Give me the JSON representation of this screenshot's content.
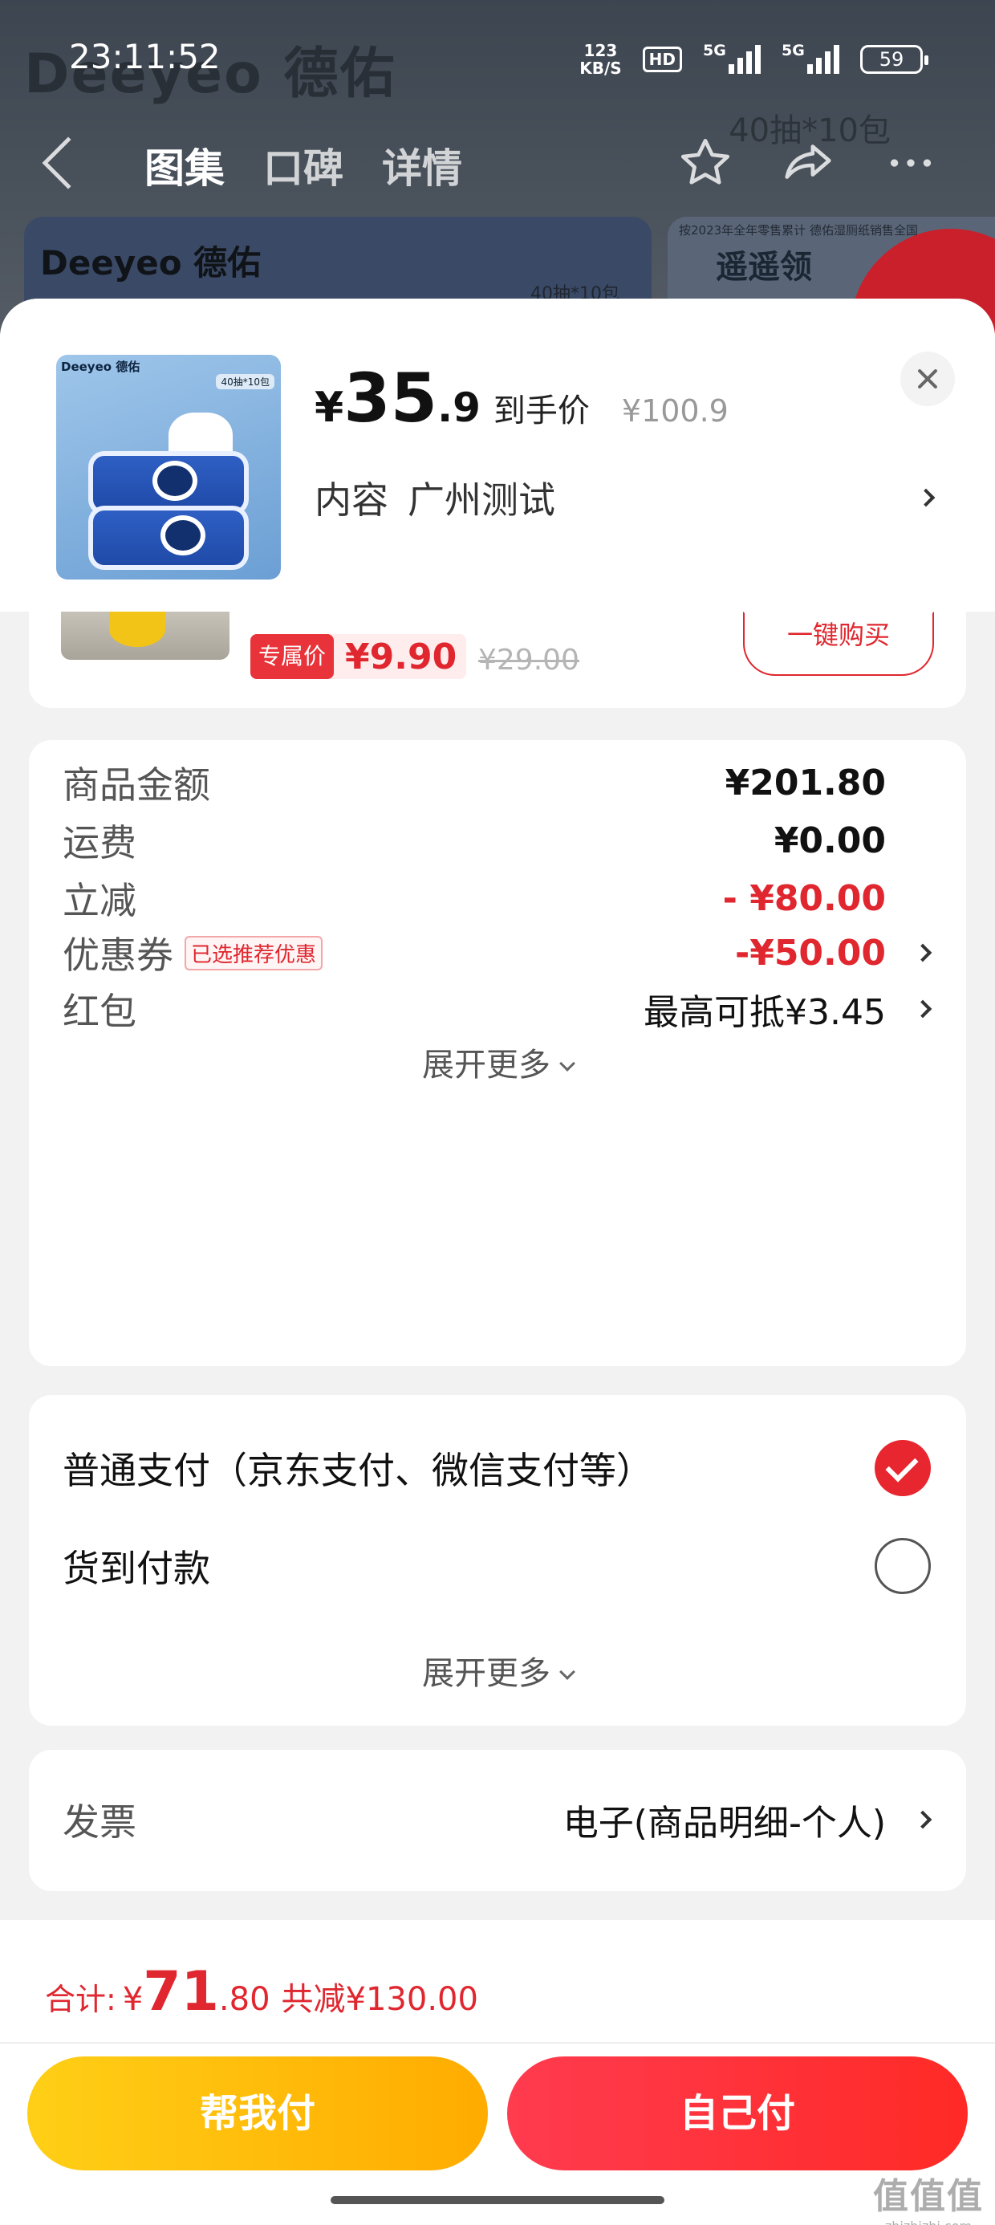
{
  "status_bar": {
    "time": "23:11:52",
    "net_speed_value": "123",
    "net_speed_unit": "KB/S",
    "hd": "HD",
    "sim1": "5G",
    "sim2": "5G",
    "battery": "59"
  },
  "background": {
    "brand": "Deeyeo 德佑",
    "pack_info": "40抽*10包",
    "tabs": [
      "图集",
      "口碑",
      "详情"
    ],
    "banner_brand": "Deeyeo 德佑",
    "banner_pack": "40抽*10包",
    "banner2_small": "按2023年全年零售累计 德佑湿厕纸销售全国",
    "banner2_big": "遥遥领"
  },
  "product": {
    "thumb_brand": "Deeyeo 德佑",
    "thumb_count": "40抽*10包",
    "price_yen": "¥",
    "price_int": "35",
    "price_dec": ".9",
    "price_label": "到手价",
    "original_price": "¥100.9",
    "spec_label": "内容",
    "spec_value": "广州测试"
  },
  "recommend_item": {
    "tag": "专属价",
    "price": "¥9.90",
    "original_price": "¥29.00",
    "buy_label": "一键购买"
  },
  "amounts": {
    "goods_label": "商品金额",
    "goods_value": "¥201.80",
    "shipping_label": "运费",
    "shipping_value": "¥0.00",
    "discount_label": "立减",
    "discount_value": "- ¥80.00",
    "coupon_label": "优惠券",
    "coupon_badge": "已选推荐优惠",
    "coupon_value": "-¥50.00",
    "redpacket_label": "红包",
    "redpacket_value": "最高可抵¥3.45",
    "expand_label": "展开更多"
  },
  "payment": {
    "option1": "普通支付（京东支付、微信支付等）",
    "option2": "货到付款",
    "expand_label": "展开更多"
  },
  "invoice": {
    "label": "发票",
    "value": "电子(商品明细-个人)"
  },
  "footer": {
    "total_label": "合计:",
    "total_yen": "¥",
    "total_int": "71",
    "total_dec": ".80",
    "saved": "共减¥130.00",
    "help_pay": "帮我付",
    "self_pay": "自己付"
  },
  "watermark": {
    "big": "值值值",
    "small": "zhizhizhi.com"
  },
  "colors": {
    "accent_red": "#e0262e",
    "yellow_button": "#ffbf0a",
    "red_button": "#ff3340"
  }
}
